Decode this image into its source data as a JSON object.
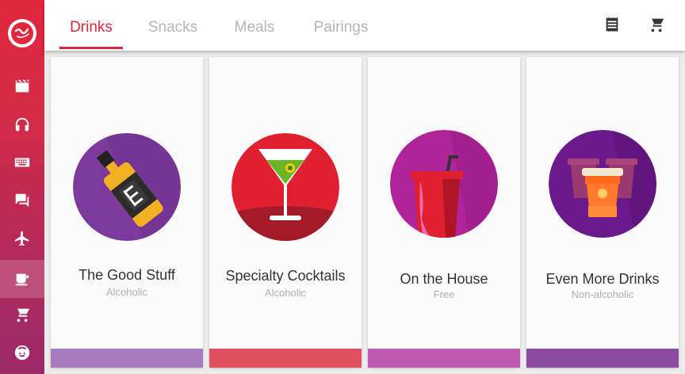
{
  "tabs": [
    {
      "label": "Drinks"
    },
    {
      "label": "Snacks"
    },
    {
      "label": "Meals"
    },
    {
      "label": "Pairings"
    }
  ],
  "active_tab": "Drinks",
  "header_icons": [
    "receipt-icon",
    "shopping-cart-icon"
  ],
  "sidebar": {
    "logo": "virgin-logo",
    "items": [
      {
        "icon": "movies-icon"
      },
      {
        "icon": "headphones-icon"
      },
      {
        "icon": "keyboard-icon"
      },
      {
        "icon": "chat-icon"
      },
      {
        "icon": "airplane-icon"
      },
      {
        "icon": "coffee-icon",
        "active": true
      },
      {
        "icon": "shopping-cart-icon"
      },
      {
        "icon": "face-icon"
      }
    ]
  },
  "cards": [
    {
      "title": "The Good Stuff",
      "subtitle": "Alcoholic",
      "icon": "whiskey-bottle-icon",
      "circle_color": "#7b3a9c",
      "bar_color": "#a37bbd"
    },
    {
      "title": "Specialty Cocktails",
      "subtitle": "Alcoholic",
      "icon": "martini-icon",
      "circle_color": "#e01f2f",
      "bar_color": "#e05060"
    },
    {
      "title": "On the House",
      "subtitle": "Free",
      "icon": "soda-cup-icon",
      "circle_color": "#b0249a",
      "bar_color": "#c05ab0"
    },
    {
      "title": "Even More Drinks",
      "subtitle": "Non-alcoholic",
      "icon": "coffee-cups-icon",
      "circle_color": "#6a1a8a",
      "bar_color": "#8a4aa0"
    }
  ],
  "colors": {
    "accent": "#e0283c",
    "tab_inactive": "#b5b5b5"
  }
}
